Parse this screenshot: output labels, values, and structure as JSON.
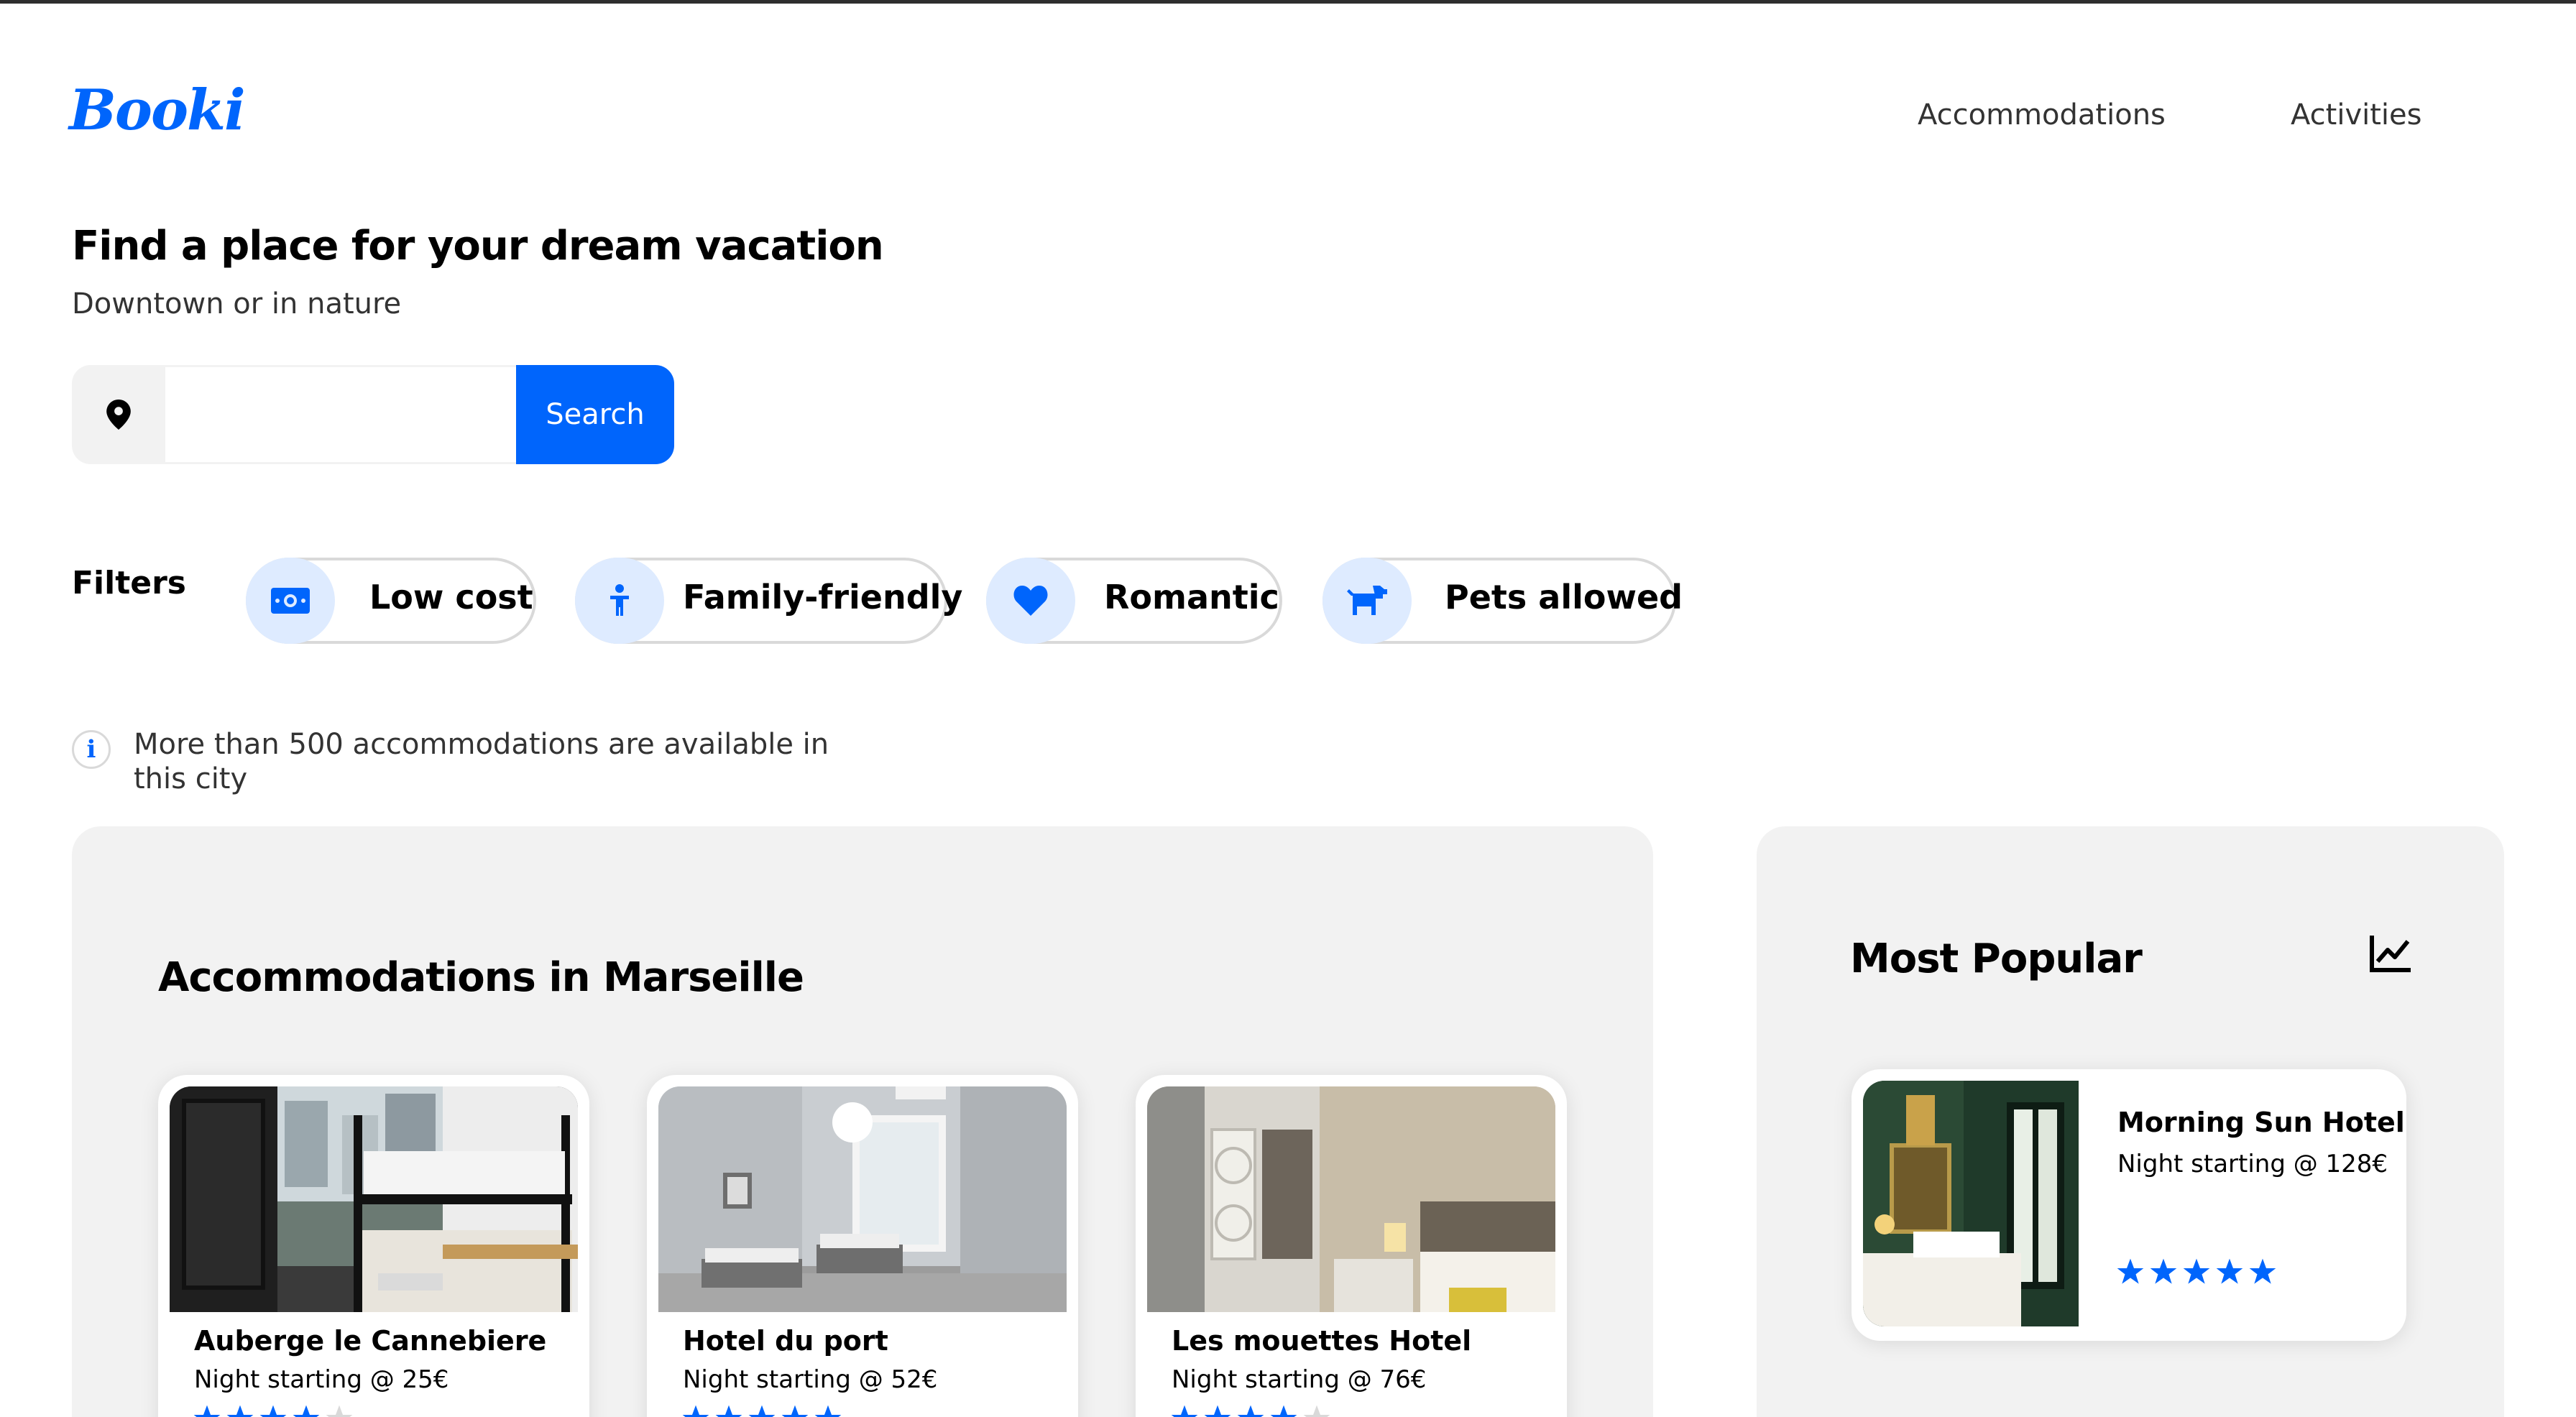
{
  "header": {
    "logo": "Booki",
    "nav": [
      "Accommodations",
      "Activities"
    ]
  },
  "hero": {
    "title": "Find a place for your dream vacation",
    "subtitle": "Downtown or in nature",
    "search": {
      "value": "",
      "placeholder": "",
      "button": "Search"
    }
  },
  "filters": {
    "label": "Filters",
    "items": [
      {
        "label": "Low cost",
        "icon": "money-bill-icon"
      },
      {
        "label": "Family-friendly",
        "icon": "child-icon"
      },
      {
        "label": "Romantic",
        "icon": "heart-icon"
      },
      {
        "label": "Pets allowed",
        "icon": "dog-icon"
      }
    ]
  },
  "info": {
    "text": "More than 500 accommodations are available in this city"
  },
  "accommodations": {
    "title": "Accommodations in Marseille",
    "items": [
      {
        "name": "Auberge le Cannebiere",
        "price": "Night starting @ 25€",
        "rating": 4
      },
      {
        "name": "Hotel du port",
        "price": "Night starting @ 52€",
        "rating": 5
      },
      {
        "name": "Les mouettes Hotel",
        "price": "Night starting @ 76€",
        "rating": 4
      }
    ]
  },
  "popular": {
    "title": "Most Popular",
    "items": [
      {
        "name": "Morning Sun Hotel",
        "price": "Night starting @ 128€",
        "rating": 5
      }
    ]
  },
  "colors": {
    "accent": "#0065fc",
    "accent_light": "#deebff",
    "panel": "#f2f2f2",
    "star_empty": "#d9d9d9"
  }
}
